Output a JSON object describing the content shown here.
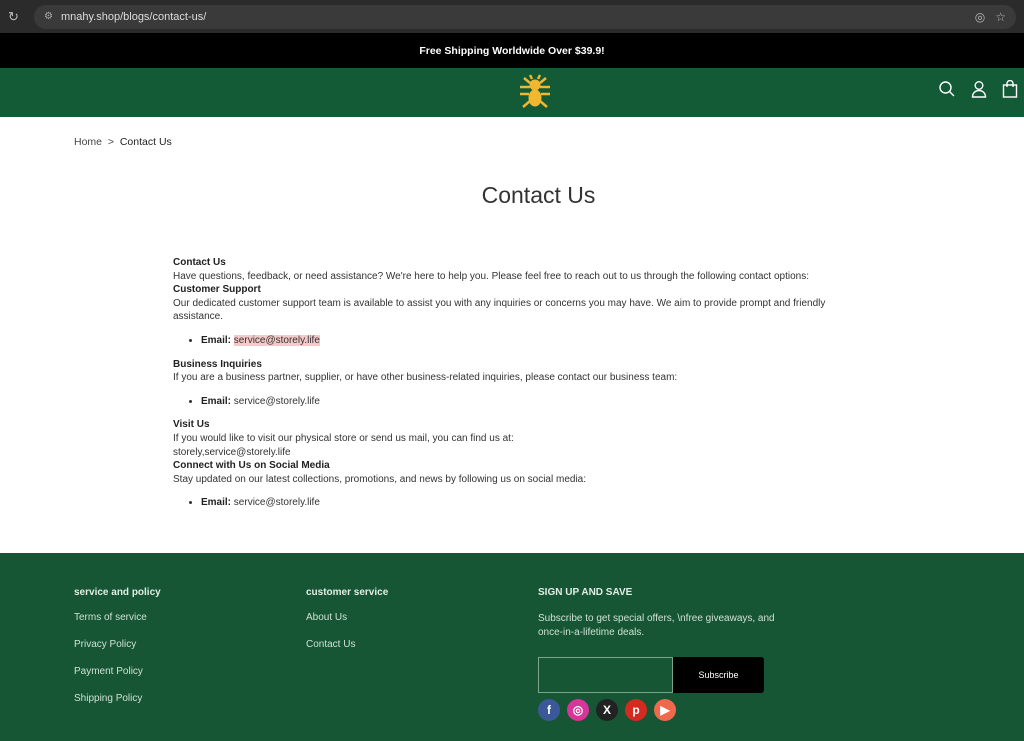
{
  "browser": {
    "url": "mnahy.shop/blogs/contact-us/"
  },
  "banner": {
    "text": "Free Shipping Worldwide Over $39.9!"
  },
  "colors": {
    "header": "#135a36",
    "footer": "#165634",
    "logo": "#f2b731"
  },
  "breadcrumb": {
    "home": "Home",
    "sep": ">",
    "current": "Contact Us"
  },
  "page_title": "Contact Us",
  "content": {
    "h_contact": "Contact Us",
    "p_contact": "Have questions, feedback, or need assistance? We're here to help you. Please feel free to reach out to us through the following contact options:",
    "h_support": "Customer Support",
    "p_support": "Our dedicated customer support team is available to assist you with any inquiries or concerns you may have. We aim to provide prompt and friendly assistance.",
    "email_label": "Email:",
    "email": "service@storely.life",
    "h_business": "Business Inquiries",
    "p_business": "If you are a business partner, supplier, or have other business-related inquiries, please contact our business team:",
    "h_visit": "Visit Us",
    "p_visit": "If you would like to visit our physical store or send us mail, you can find us at:",
    "p_visit2": "storely,service@storely.life",
    "h_social": "Connect with Us on Social Media",
    "p_social": "Stay updated on our latest collections, promotions, and news by following us on social media:"
  },
  "footer": {
    "col1": {
      "title": "service and policy",
      "links": [
        "Terms of service",
        "Privacy Policy",
        "Payment Policy",
        "Shipping Policy"
      ]
    },
    "col2": {
      "title": "customer service",
      "links": [
        "About Us",
        "Contact Us"
      ]
    },
    "col3": {
      "title": "SIGN UP AND SAVE",
      "desc": "Subscribe to get special offers, \\nfree giveaways, and once-in-a-lifetime deals.",
      "email_value": "",
      "subscribe": "Subscribe"
    },
    "social": [
      "facebook",
      "instagram",
      "x",
      "pinterest",
      "youtube"
    ]
  }
}
